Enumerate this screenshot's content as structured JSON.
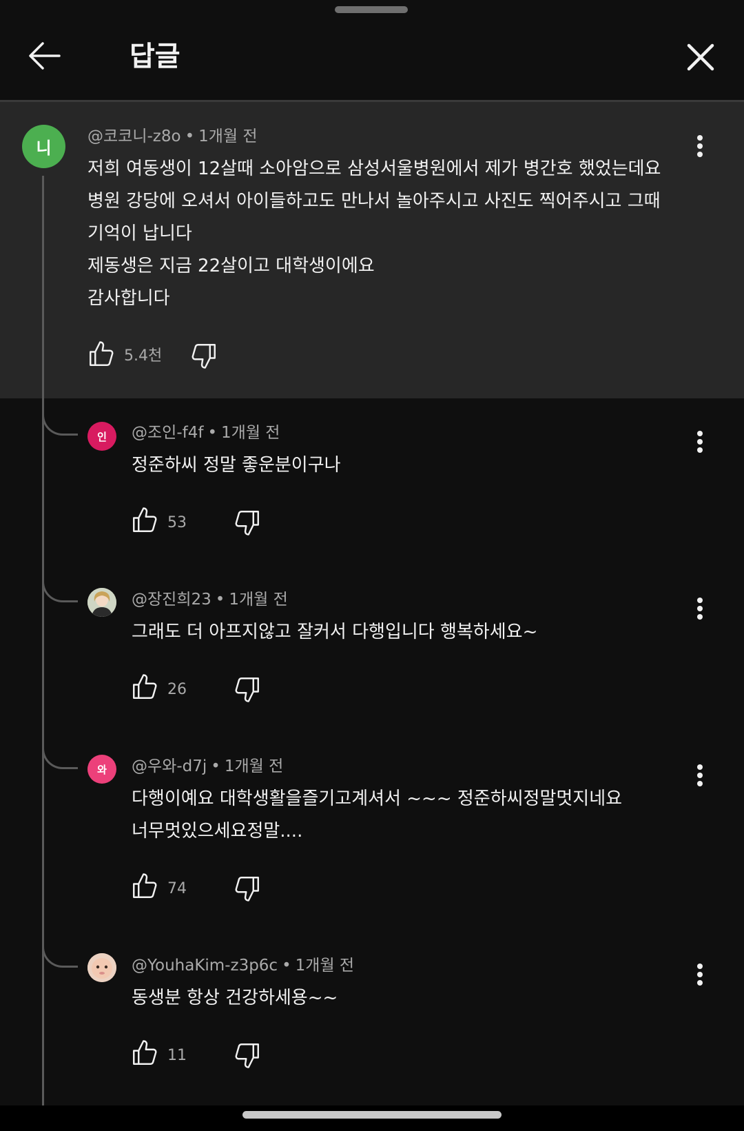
{
  "header": {
    "title": "답글",
    "back_icon": "arrow-left-icon",
    "close_icon": "close-icon"
  },
  "colors": {
    "background": "#0f0f0f",
    "highlight": "#272727",
    "text": "#f1f1f1",
    "secondary_text": "#aaaaaa"
  },
  "parent": {
    "avatar_letter": "니",
    "avatar_color": "#4caf50",
    "author": "@코코니-z8o",
    "time": "1개월 전",
    "lines": [
      "저희 여동생이 12살때 소아암으로 삼성서울병원에서 제가 병간호 했었는데요",
      "병원 강당에 오셔서 아이들하고도 만나서 놀아주시고 사진도 찍어주시고 그때",
      "기억이 납니다",
      "제동생은 지금 22살이고 대학생이에요",
      "감사합니다"
    ],
    "likes": "5.4천"
  },
  "replies": [
    {
      "avatar_letter": "인",
      "avatar_color": "#d81b60",
      "author": "@조인-f4f",
      "time": "1개월 전",
      "lines": [
        "정준하씨 정말 좋운분이구나"
      ],
      "likes": "53"
    },
    {
      "avatar_letter": "",
      "avatar_color": "#d9dccb",
      "author": "@장진희23",
      "time": "1개월 전",
      "lines": [
        "그래도 더 아프지않고 잘커서 다행입니다 행복하세요~"
      ],
      "likes": "26"
    },
    {
      "avatar_letter": "와",
      "avatar_color": "#ec407a",
      "author": "@우와-d7j",
      "time": "1개월 전",
      "lines": [
        "다행이예요 대학생활을즐기고계셔서 ~~~ 정준하씨정말멋지네요",
        "너무멋있으세요정말...."
      ],
      "likes": "74"
    },
    {
      "avatar_letter": "",
      "avatar_color": "#e9c3b0",
      "author": "@YouhaKim-z3p6c",
      "time": "1개월 전",
      "lines": [
        "동생분 항상 건강하세용~~"
      ],
      "likes": "11"
    }
  ],
  "separator": "•"
}
